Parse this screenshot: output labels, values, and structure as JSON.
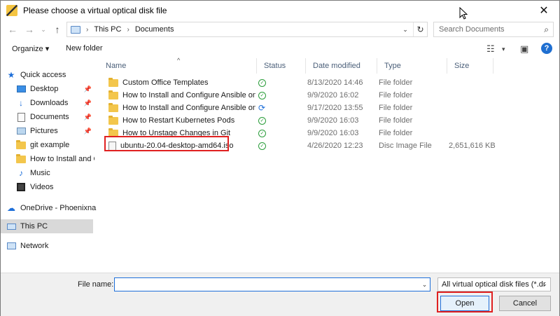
{
  "window": {
    "title": "Please choose a virtual optical disk file",
    "close_glyph": "✕"
  },
  "address": {
    "crumbs": [
      "This PC",
      "Documents"
    ],
    "search_placeholder": "Search Documents"
  },
  "toolbar": {
    "organize_label": "Organize ▾",
    "new_folder_label": "New folder",
    "help_label": "?"
  },
  "nav": {
    "quick_access": "Quick access",
    "items": [
      {
        "label": "Desktop",
        "pinned": true
      },
      {
        "label": "Downloads",
        "pinned": true
      },
      {
        "label": "Documents",
        "pinned": true
      },
      {
        "label": "Pictures",
        "pinned": true
      },
      {
        "label": "git example"
      },
      {
        "label": "How to Install and C"
      },
      {
        "label": "Music"
      },
      {
        "label": "Videos"
      }
    ],
    "onedrive": "OneDrive - Phoenixna",
    "this_pc": "This PC",
    "network": "Network"
  },
  "columns": {
    "name": "Name",
    "status": "Status",
    "date": "Date modified",
    "type": "Type",
    "size": "Size"
  },
  "files": [
    {
      "name": "Custom Office Templates",
      "status": "ok",
      "date": "8/13/2020 14:46",
      "type": "File folder",
      "size": ""
    },
    {
      "name": "How to Install and Configure Ansible on ...",
      "status": "ok",
      "date": "9/9/2020 16:02",
      "type": "File folder",
      "size": ""
    },
    {
      "name": "How to Install and Configure Ansible on ...",
      "status": "sync",
      "date": "9/17/2020 13:55",
      "type": "File folder",
      "size": ""
    },
    {
      "name": "How to Restart Kubernetes Pods",
      "status": "ok",
      "date": "9/9/2020 16:03",
      "type": "File folder",
      "size": ""
    },
    {
      "name": "How to Unstage Changes in Git",
      "status": "ok",
      "date": "9/9/2020 16:03",
      "type": "File folder",
      "size": ""
    },
    {
      "name": "ubuntu-20.04-desktop-amd64.iso",
      "status": "ok",
      "date": "4/26/2020 12:23",
      "type": "Disc Image File",
      "size": "2,651,616 KB"
    }
  ],
  "bottom": {
    "file_name_label": "File name:",
    "file_name_value": "",
    "filter_label": "All virtual optical disk files (*.dr",
    "open_label": "Open",
    "cancel_label": "Cancel"
  },
  "colors": {
    "accent": "#1e6fd9",
    "highlight": "#e02020",
    "folder": "#f3c64c"
  }
}
